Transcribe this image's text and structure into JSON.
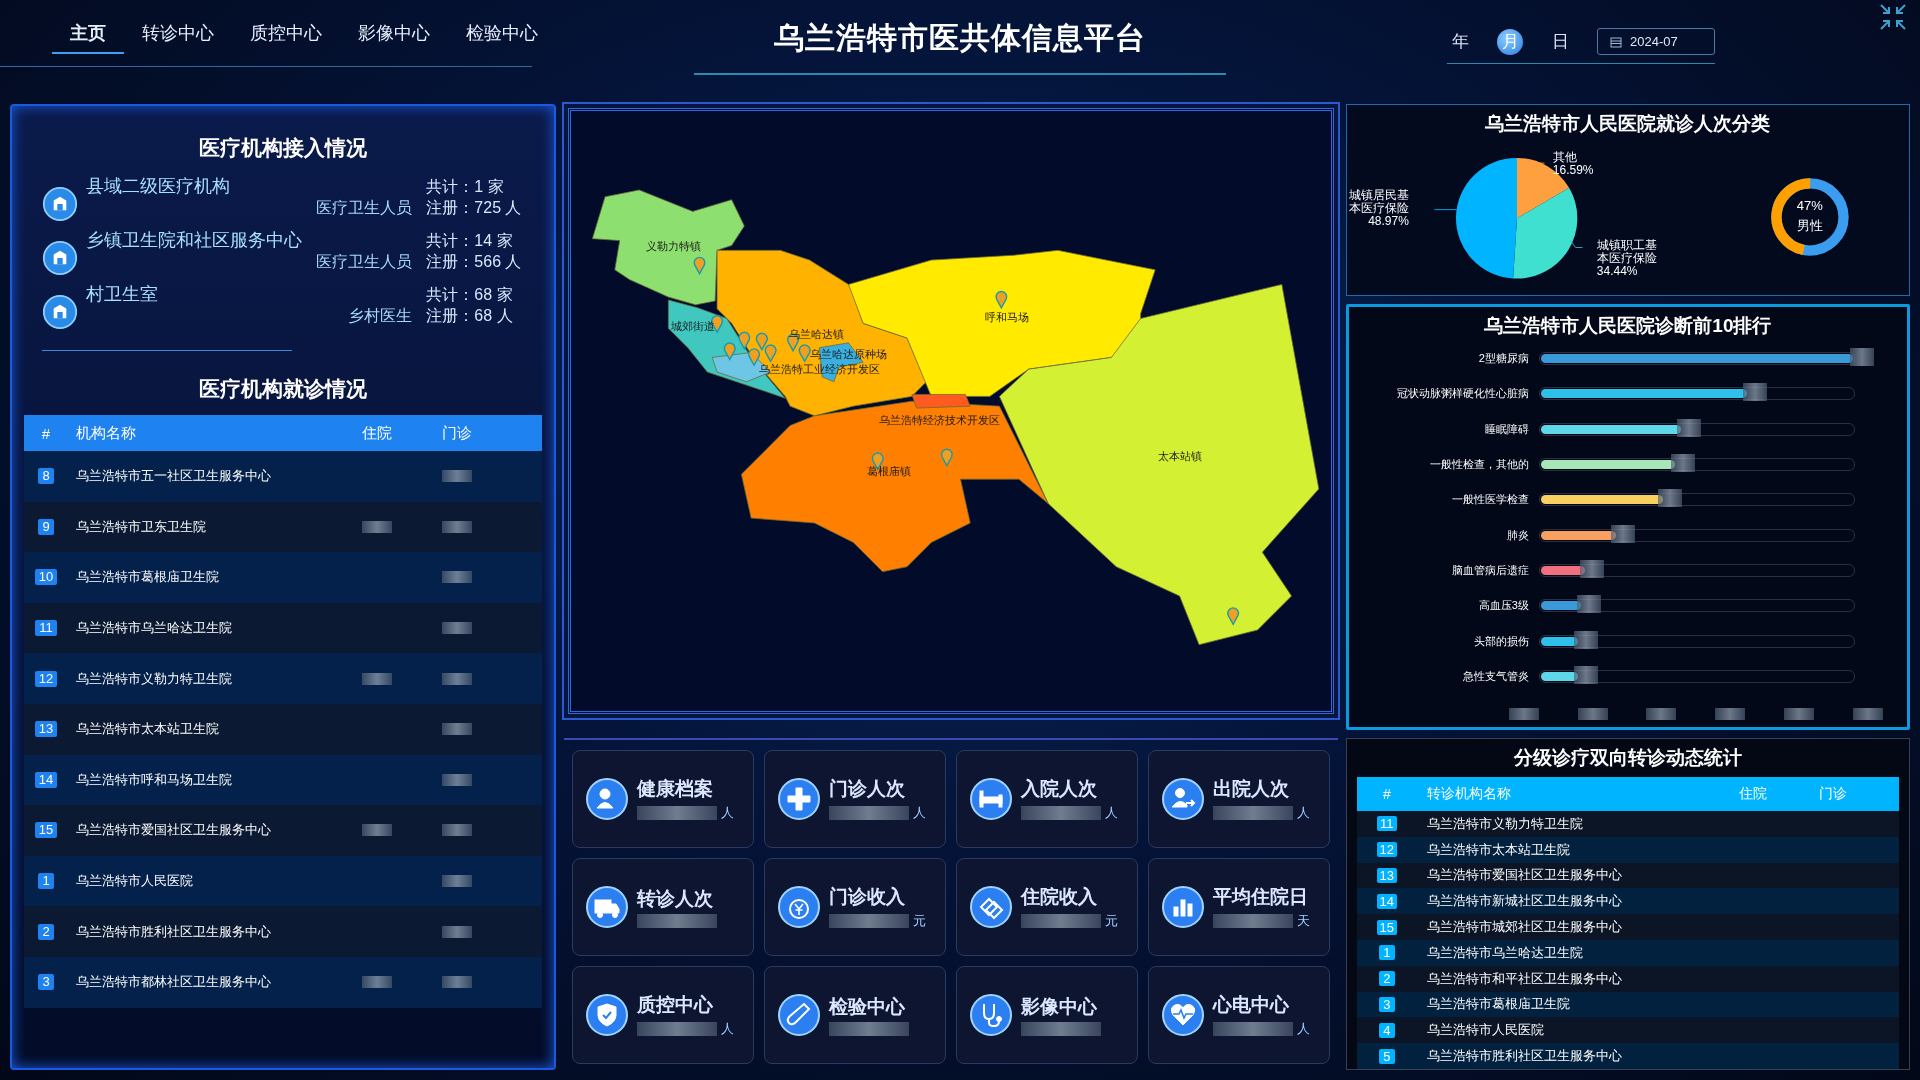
{
  "header": {
    "tabs": [
      {
        "label": "主页",
        "selected": true
      },
      {
        "label": "转诊中心",
        "selected": false
      },
      {
        "label": "质控中心",
        "selected": false
      },
      {
        "label": "影像中心",
        "selected": false
      },
      {
        "label": "检验中心",
        "selected": false
      }
    ],
    "title": "乌兰浩特市医共体信息平台",
    "period_units": [
      {
        "label": "年",
        "selected": false
      },
      {
        "label": "月",
        "selected": true
      },
      {
        "label": "日",
        "selected": false
      }
    ],
    "date": {
      "value": "2024-07"
    }
  },
  "access_panel": {
    "title": "医疗机构接入情况",
    "items": [
      {
        "name": "县域二级医疗机构",
        "total": "共计：1 家",
        "staff_label": "医疗卫生人员",
        "registered": "注册：725 人"
      },
      {
        "name": "乡镇卫生院和社区服务中心",
        "total": "共计：14 家",
        "staff_label": "医疗卫生人员",
        "registered": "注册：566 人"
      },
      {
        "name": "村卫生室",
        "total": "共计：68 家",
        "staff_label": "乡村医生",
        "registered": "注册：68 人"
      }
    ]
  },
  "visits_panel": {
    "title": "医疗机构就诊情况",
    "columns": [
      "#",
      "机构名称",
      "住院",
      "门诊"
    ],
    "rows": [
      {
        "rank": "8",
        "name": "乌兰浩特市五一社区卫生服务中心"
      },
      {
        "rank": "9",
        "name": "乌兰浩特市卫东卫生院"
      },
      {
        "rank": "10",
        "name": "乌兰浩特市葛根庙卫生院"
      },
      {
        "rank": "11",
        "name": "乌兰浩特市乌兰哈达卫生院"
      },
      {
        "rank": "12",
        "name": "乌兰浩特市义勒力特卫生院"
      },
      {
        "rank": "13",
        "name": "乌兰浩特市太本站卫生院"
      },
      {
        "rank": "14",
        "name": "乌兰浩特市呼和马场卫生院"
      },
      {
        "rank": "15",
        "name": "乌兰浩特市爱国社区卫生服务中心"
      },
      {
        "rank": "1",
        "name": "乌兰浩特市人民医院"
      },
      {
        "rank": "2",
        "name": "乌兰浩特市胜利社区卫生服务中心"
      },
      {
        "rank": "3",
        "name": "乌兰浩特市都林社区卫生服务中心"
      }
    ]
  },
  "map": {
    "regions": [
      {
        "name": "义勒力特镇",
        "color": "#8ddf6f"
      },
      {
        "name": "乌兰哈达镇",
        "color": "#ffb300"
      },
      {
        "name": "呼和马场",
        "color": "#ffea00"
      },
      {
        "name": "太本站镇",
        "color": "#d4f032"
      },
      {
        "name": "葛根庙镇",
        "color": "#ff7f00"
      },
      {
        "name": "城郊街道",
        "color": "#40c8c0"
      },
      {
        "name": "乌兰哈达原种场",
        "color": "#3ab0e0"
      },
      {
        "name": "乌兰浩特工业经济开发区",
        "color": "#6ec6e6"
      },
      {
        "name": "乌兰浩特经济技术开发区",
        "color": "#ff5a1f"
      }
    ]
  },
  "stat_tiles": [
    {
      "title": "健康档案",
      "unit": "人"
    },
    {
      "title": "门诊人次",
      "unit": "人"
    },
    {
      "title": "入院人次",
      "unit": "人"
    },
    {
      "title": "出院人次",
      "unit": "人"
    },
    {
      "title": "转诊人次"
    },
    {
      "title": "门诊收入",
      "unit": "元"
    },
    {
      "title": "住院收入",
      "unit": "元"
    },
    {
      "title": "平均住院日",
      "unit": "天"
    },
    {
      "title": "质控中心",
      "unit": "人"
    },
    {
      "title": "检验中心"
    },
    {
      "title": "影像中心"
    },
    {
      "title": "心电中心",
      "unit": "人"
    }
  ],
  "visit_types": {
    "title": "乌兰浩特市人民医院就诊人次分类",
    "chart_data": {
      "type": "pie",
      "categories": [
        "其他",
        "城镇职工基本医疗保险",
        "城镇居民基本医疗保险"
      ],
      "series": [
        {
          "values": [
            16.59,
            34.44,
            48.97
          ]
        }
      ],
      "value_labels": [
        "16.59%",
        "34.44%",
        "48.97%"
      ]
    },
    "gender": {
      "percent": "47%",
      "label": "男性",
      "level": 0.47
    }
  },
  "diagnoses": {
    "title": "乌兰浩特市人民医院诊断前10排行",
    "items": [
      {
        "name": "2型糖尿病",
        "level": 1,
        "color": "#3a9ad9"
      },
      {
        "name": "冠状动脉粥样硬化性心脏病",
        "level": 0.66,
        "color": "#2ec0e8"
      },
      {
        "name": "睡眠障碍",
        "level": 0.45,
        "color": "#5ed8e8"
      },
      {
        "name": "一般性检查，其他的",
        "level": 0.43,
        "color": "#a8e8b8"
      },
      {
        "name": "一般性医学检查",
        "level": 0.39,
        "color": "#f8d060"
      },
      {
        "name": "肺炎",
        "level": 0.24,
        "color": "#f8a060"
      },
      {
        "name": "脑血管病后遗症",
        "level": 0.14,
        "color": "#f07080"
      },
      {
        "name": "高血压3级",
        "level": 0.13,
        "color": "#3a9ad9"
      },
      {
        "name": "头部的损伤",
        "level": 0.12,
        "color": "#2ec0e8"
      },
      {
        "name": "急性支气管炎",
        "level": 0.12,
        "color": "#5ed8e8"
      }
    ]
  },
  "referrals": {
    "title": "分级诊疗双向转诊动态统计",
    "columns": [
      "#",
      "转诊机构名称",
      "住院",
      "门诊"
    ],
    "rows": [
      {
        "rank": "11",
        "name": "乌兰浩特市义勒力特卫生院"
      },
      {
        "rank": "12",
        "name": "乌兰浩特市太本站卫生院"
      },
      {
        "rank": "13",
        "name": "乌兰浩特市爱国社区卫生服务中心"
      },
      {
        "rank": "14",
        "name": "乌兰浩特市新城社区卫生服务中心"
      },
      {
        "rank": "15",
        "name": "乌兰浩特市城郊社区卫生服务中心"
      },
      {
        "rank": "1",
        "name": "乌兰浩特市乌兰哈达卫生院"
      },
      {
        "rank": "2",
        "name": "乌兰浩特市和平社区卫生服务中心"
      },
      {
        "rank": "3",
        "name": "乌兰浩特市葛根庙卫生院"
      },
      {
        "rank": "4",
        "name": "乌兰浩特市人民医院"
      },
      {
        "rank": "5",
        "name": "乌兰浩特市胜利社区卫生服务中心"
      }
    ]
  }
}
